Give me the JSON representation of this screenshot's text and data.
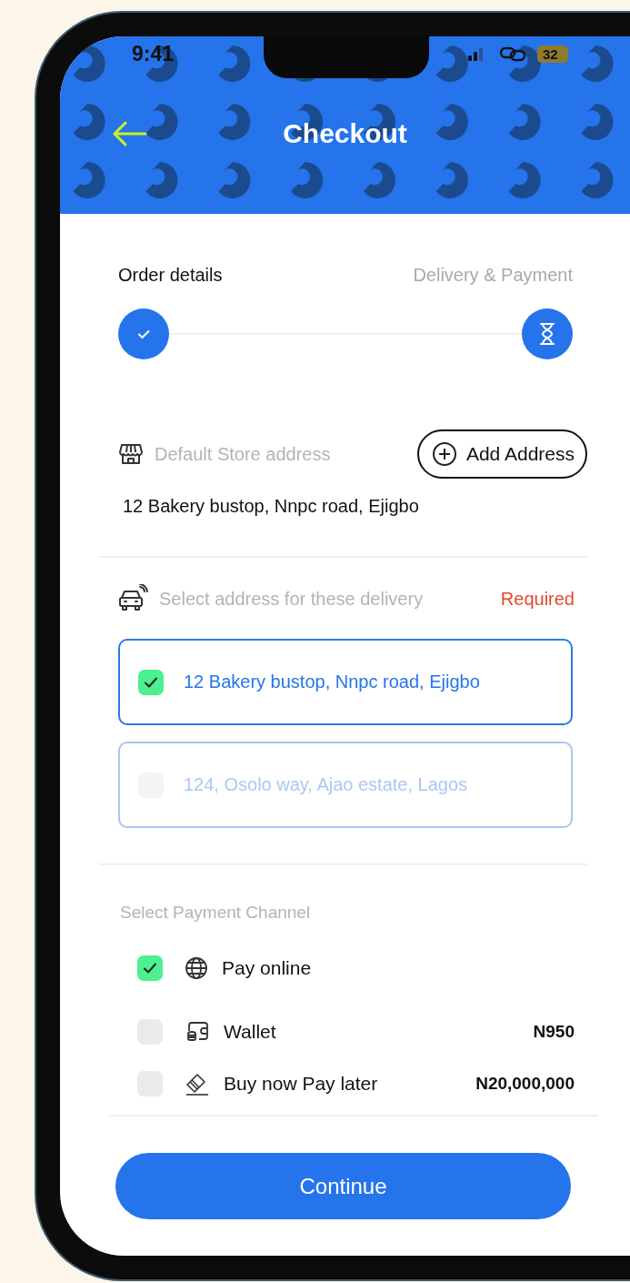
{
  "status_bar": {
    "time": "9:41",
    "battery": "32"
  },
  "header": {
    "title": "Checkout"
  },
  "steps": [
    {
      "label": "Order details",
      "completed": true
    },
    {
      "label": "Delivery & Payment",
      "completed": false
    }
  ],
  "store": {
    "label": "Default Store address",
    "button": "Add Address",
    "address": "12 Bakery bustop, Nnpc road, Ejigbo"
  },
  "delivery": {
    "label": "Select address for these delivery",
    "required": "Required",
    "addresses": [
      {
        "text": "12 Bakery bustop, Nnpc road, Ejigbo",
        "selected": true
      },
      {
        "text": "124, Osolo way, Ajao estate, Lagos",
        "selected": false
      }
    ]
  },
  "payment": {
    "heading": "Select Payment Channel",
    "channels": [
      {
        "kind": "online",
        "label": "Pay online",
        "selected": true
      },
      {
        "kind": "wallet",
        "label": "Wallet",
        "amount": "N950",
        "selected": false
      },
      {
        "kind": "credit",
        "label": "Buy now Pay later",
        "amount": "N20,000,000",
        "selected": false
      }
    ]
  },
  "continue_button": "Continue"
}
